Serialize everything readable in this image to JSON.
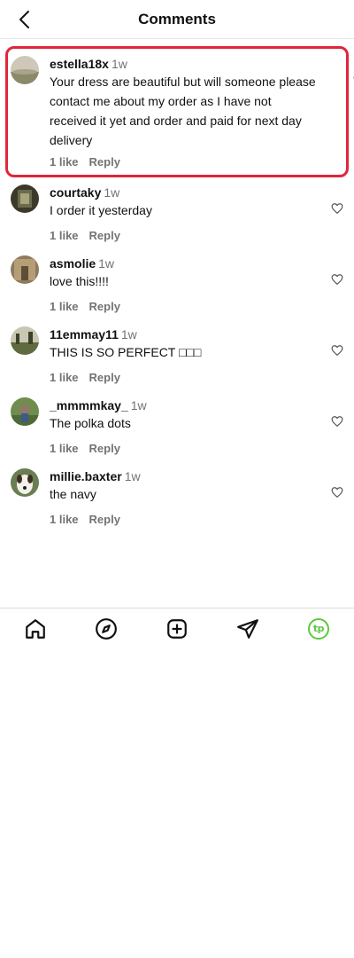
{
  "header": {
    "title": "Comments"
  },
  "comments": [
    {
      "username": "estella18x",
      "time": "1w",
      "text": "Your dress are beautiful but will someone please contact me about my order as I have not received it yet and order and paid for next day delivery",
      "likes": "1 like",
      "reply": "Reply"
    },
    {
      "username": "courtaky",
      "time": "1w",
      "text": "I order it yesterday",
      "likes": "1 like",
      "reply": "Reply"
    },
    {
      "username": "asmolie",
      "time": "1w",
      "text": "love this!!!!",
      "likes": "1 like",
      "reply": "Reply"
    },
    {
      "username": "11emmay11",
      "time": "1w",
      "text": "THIS IS SO PERFECT □□□",
      "likes": "1 like",
      "reply": "Reply"
    },
    {
      "username": "_mmmmkay_",
      "time": "1w",
      "text": "The polka dots",
      "likes": "1 like",
      "reply": "Reply"
    },
    {
      "username": "millie.baxter",
      "time": "1w",
      "text": "the navy",
      "likes": "1 like",
      "reply": "Reply"
    }
  ],
  "tabbar": {
    "icons": [
      "home-icon",
      "explore-icon",
      "create-icon",
      "direct-icon",
      "profile-icon"
    ],
    "profile_logo": "tp"
  },
  "colors": {
    "highlight": "#e0263b",
    "meta": "#737373",
    "logo": "#5cc93f"
  }
}
